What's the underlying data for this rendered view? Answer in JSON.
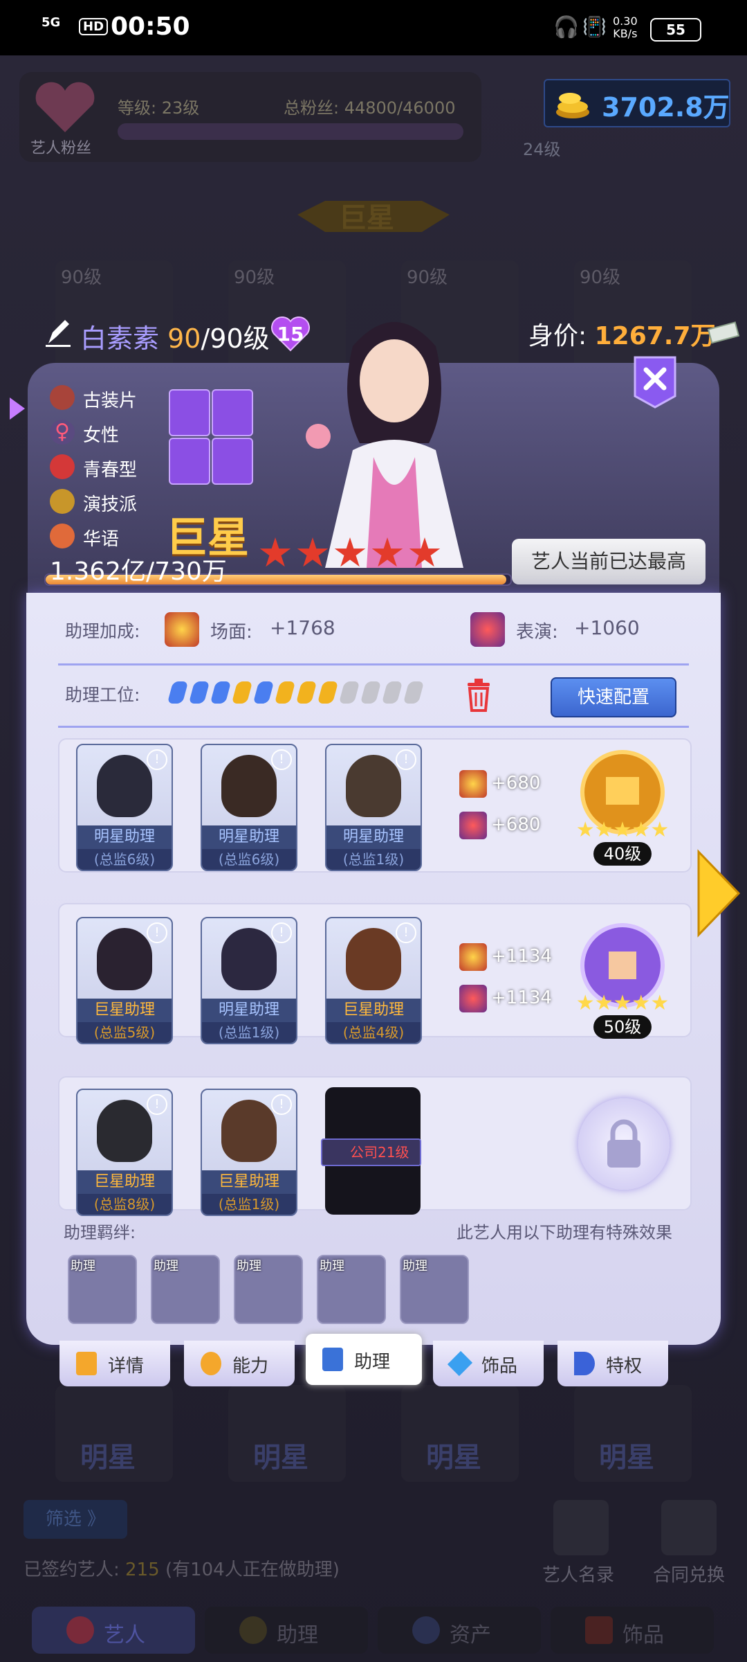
{
  "status_bar": {
    "signal": "5G",
    "hd": "HD",
    "time": "00:50",
    "net_speed": "0.30",
    "net_unit": "KB/s",
    "battery": "55"
  },
  "header": {
    "fans_label": "艺人粉丝",
    "level_text": "等级: 23级",
    "fans_text": "总粉丝: 44800/46000",
    "coins": "3702.8万",
    "level_badge": "24级"
  },
  "banner": {
    "title": "巨星"
  },
  "bg_cards": {
    "level": "90级",
    "star_label": "明星"
  },
  "artist": {
    "name": "白素素",
    "level_current": "90",
    "level_max": "/90级",
    "heart_count": "15",
    "worth_label": "身价:",
    "worth_value": "1267.7万",
    "tags": [
      "古装片",
      "女性",
      "青春型",
      "演技派",
      "华语"
    ],
    "rank": "巨星",
    "stars": "★★★★★",
    "exp_text": "1.362亿/730万",
    "exp_progress": 1.0,
    "max_button": "艺人当前已达最高"
  },
  "bonus": {
    "label": "助理加成:",
    "scene_name": "场面:",
    "scene_value": "+1768",
    "acting_name": "表演:",
    "acting_value": "+1060"
  },
  "slots": {
    "label": "助理工位:",
    "colors": [
      "#4a7ef0",
      "#4a7ef0",
      "#4a7ef0",
      "#f2b21e",
      "#4a7ef0",
      "#f2b21e",
      "#f2b21e",
      "#f2b21e",
      "#c4c4cc",
      "#c4c4cc",
      "#c4c4cc",
      "#c4c4cc"
    ],
    "quick_button": "快速配置"
  },
  "rows": [
    {
      "cards": [
        {
          "name": "明星助理",
          "sub": "(总监6级)",
          "kind": "star",
          "color": "#2a2a3a"
        },
        {
          "name": "明星助理",
          "sub": "(总监6级)",
          "kind": "star",
          "color": "#3a2a24"
        },
        {
          "name": "明星助理",
          "sub": "(总监1级)",
          "kind": "star",
          "color": "#4a3a30"
        }
      ],
      "bonus1": "+680",
      "bonus2": "+680",
      "medal_level": "40级"
    },
    {
      "cards": [
        {
          "name": "巨星助理",
          "sub": "(总监5级)",
          "kind": "super",
          "color": "#2a2230"
        },
        {
          "name": "明星助理",
          "sub": "(总监1级)",
          "kind": "star",
          "color": "#2c2840"
        },
        {
          "name": "巨星助理",
          "sub": "(总监4级)",
          "kind": "super",
          "color": "#6a3a24"
        }
      ],
      "bonus1": "+1134",
      "bonus2": "+1134",
      "medal_level": "50级"
    },
    {
      "cards": [
        {
          "name": "巨星助理",
          "sub": "(总监8级)",
          "kind": "super",
          "color": "#2a2a30"
        },
        {
          "name": "巨星助理",
          "sub": "(总监1级)",
          "kind": "super",
          "color": "#5a3a2a"
        }
      ],
      "locked_text": "公司21级"
    }
  ],
  "bond": {
    "label": "助理羁绊:",
    "desc": "此艺人用以下助理有特殊效果",
    "tag": "助理",
    "count": 5
  },
  "tabs": [
    {
      "label": "详情",
      "icon": "document-icon"
    },
    {
      "label": "能力",
      "icon": "hexagon-icon"
    },
    {
      "label": "助理",
      "icon": "badge-icon"
    },
    {
      "label": "饰品",
      "icon": "diamond-icon"
    },
    {
      "label": "特权",
      "icon": "megaphone-icon"
    }
  ],
  "bottom": {
    "filter": "筛选 》",
    "signed_label": "已签约艺人:",
    "signed_count": "215",
    "signed_note": "(有104人正在做助理)",
    "roster": "艺人名录",
    "exchange": "合同兑换",
    "nav": [
      "艺人",
      "助理",
      "资产",
      "饰品"
    ]
  },
  "colors": {
    "accent_blue": "#5c8ff0",
    "gold": "#ffae3b",
    "purple": "#a99dff"
  }
}
